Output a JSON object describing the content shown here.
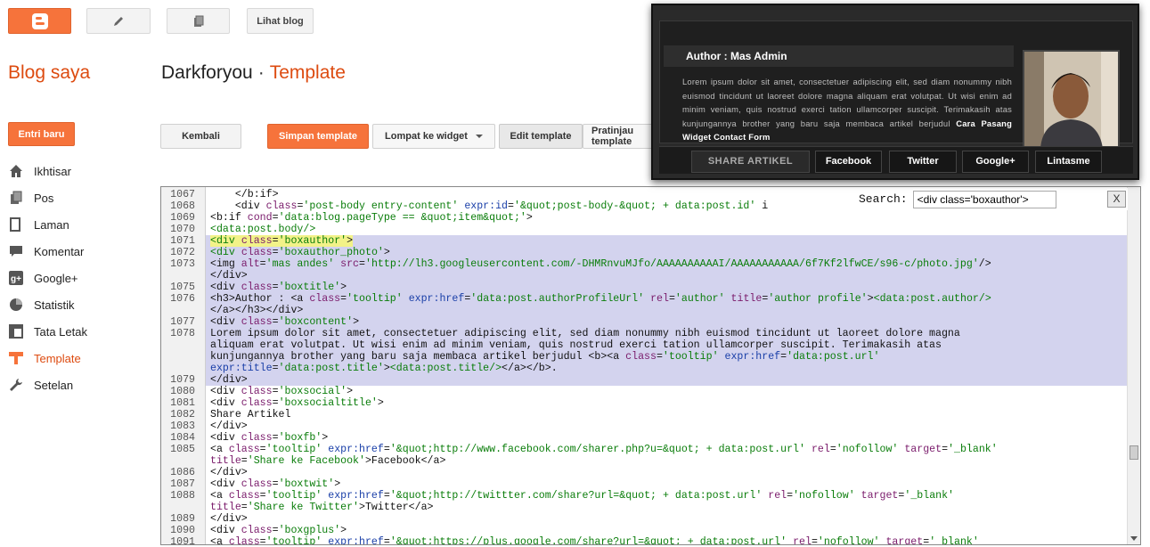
{
  "topbar": {
    "view_blog_label": "Lihat blog"
  },
  "header": {
    "brand": "Blog saya",
    "blog_name": "Darkforyou",
    "separator": "·",
    "section": "Template"
  },
  "sidebar": {
    "new_post_label": "Entri baru",
    "items": [
      {
        "label": "Ikhtisar",
        "icon": "home-icon"
      },
      {
        "label": "Pos",
        "icon": "posts-icon"
      },
      {
        "label": "Laman",
        "icon": "pages-icon"
      },
      {
        "label": "Komentar",
        "icon": "comment-icon"
      },
      {
        "label": "Google+",
        "icon": "google-plus-icon"
      },
      {
        "label": "Statistik",
        "icon": "pie-chart-icon"
      },
      {
        "label": "Tata Letak",
        "icon": "layout-icon"
      },
      {
        "label": "Template",
        "icon": "template-icon",
        "active": true
      },
      {
        "label": "Setelan",
        "icon": "wrench-icon"
      }
    ]
  },
  "toolbar": {
    "back_label": "Kembali",
    "save_label": "Simpan template",
    "jump_label": "Lompat ke widget",
    "edit_label": "Edit template",
    "preview_label": "Pratinjau template"
  },
  "search": {
    "label": "Search:",
    "value": "<div class='boxauthor'>",
    "close_label": "X"
  },
  "widget": {
    "title": "Author : Mas Admin",
    "body": "Lorem ipsum dolor sit amet, consectetuer adipiscing elit, sed diam nonummy nibh euismod tincidunt ut laoreet dolore magna aliquam erat volutpat. Ut wisi enim ad minim veniam, quis nostrud exerci tation ullamcorper suscipit. Terimakasih atas kunjungannya brother yang baru saja membaca artikel berjudul",
    "link": "Cara Pasang Widget Contact Form",
    "share_label": "SHARE ARTIKEL",
    "buttons": [
      "Facebook",
      "Twitter",
      "Google+",
      "Lintasme"
    ]
  },
  "editor": {
    "lines": [
      {
        "n": "1067",
        "html": "    &lt;/b:if&gt;"
      },
      {
        "n": "1068",
        "html": "    &lt;div <span class='p'>class</span>=<span class='g'>'post-body entry-content'</span> <span class='b'>expr:id</span>=<span class='g'>'&amp;quot;post-body-&amp;quot; + data:post.id'</span> i"
      },
      {
        "n": "1069",
        "html": "&lt;b:if <span class='p'>cond</span>=<span class='g'>'data:blog.pageType == &amp;quot;item&amp;quot;'</span>&gt;"
      },
      {
        "n": "1070",
        "html": "<span class='g'>&lt;data:post.body/&gt;</span>"
      },
      {
        "n": "1071",
        "sel": true,
        "hl": true,
        "html": "<span class='first'><span class='g'>&lt;div</span> <span class='p'>class</span>=<span class='g'>'boxauthor'</span>&gt;</span>"
      },
      {
        "n": "1072",
        "sel": true,
        "html": "<span class='g'>&lt;div</span> <span class='p'>class</span>=<span class='g'>'boxauthor_photo'</span>&gt;"
      },
      {
        "n": "1073",
        "sel": true,
        "html": "&lt;img <span class='p'>alt</span>=<span class='g'>'mas andes'</span> <span class='p'>src</span>=<span class='g'>'http://lh3.googleusercontent.com/-DHMRnvuMJfo/AAAAAAAAAAI/AAAAAAAAAAA/6f7Kf2lfwCE/s96-c/photo.jpg'</span>/&gt;"
      },
      {
        "n": "",
        "sel": true,
        "html": "&lt;/div&gt;"
      },
      {
        "n": "1075",
        "sel": true,
        "html": "&lt;div <span class='p'>class</span>=<span class='g'>'boxtitle'</span>&gt;"
      },
      {
        "n": "1076",
        "sel": true,
        "html": "&lt;h3&gt;Author : &lt;a <span class='p'>class</span>=<span class='g'>'tooltip'</span> <span class='b'>expr:href</span>=<span class='g'>'data:post.authorProfileUrl'</span> <span class='p'>rel</span>=<span class='g'>'author'</span> <span class='p'>title</span>=<span class='g'>'author profile'</span>&gt;<span class='g'>&lt;data:post.author/&gt;</span>\n&lt;/a&gt;&lt;/h3&gt;&lt;/div&gt;"
      },
      {
        "n": "1077",
        "sel": true,
        "html": "&lt;div <span class='p'>class</span>=<span class='g'>'boxcontent'</span>&gt;"
      },
      {
        "n": "1078",
        "sel": true,
        "html": "Lorem ipsum dolor sit amet, consectetuer adipiscing elit, sed diam nonummy nibh euismod tincidunt ut laoreet dolore magna\naliquam erat volutpat. Ut wisi enim ad minim veniam, quis nostrud exerci tation ullamcorper suscipit. Terimakasih atas\nkunjungannya brother yang baru saja membaca artikel berjudul &lt;b&gt;&lt;a <span class='p'>class</span>=<span class='g'>'tooltip'</span> <span class='b'>expr:href</span>=<span class='g'>'data:post.url'</span>\n<span class='b'>expr:title</span>=<span class='g'>'data:post.title'</span>&gt;<span class='g'>&lt;data:post.title/&gt;</span>&lt;/a&gt;&lt;/b&gt;."
      },
      {
        "n": "1079",
        "sel": true,
        "html": "&lt;/div&gt;"
      },
      {
        "n": "1080",
        "html": "&lt;div <span class='p'>class</span>=<span class='g'>'boxsocial'</span>&gt;"
      },
      {
        "n": "1081",
        "html": "&lt;div <span class='p'>class</span>=<span class='g'>'boxsocialtitle'</span>&gt;"
      },
      {
        "n": "1082",
        "html": "Share Artikel"
      },
      {
        "n": "1083",
        "html": "&lt;/div&gt;"
      },
      {
        "n": "1084",
        "html": "&lt;div <span class='p'>class</span>=<span class='g'>'boxfb'</span>&gt;"
      },
      {
        "n": "1085",
        "html": "&lt;a <span class='p'>class</span>=<span class='g'>'tooltip'</span> <span class='b'>expr:href</span>=<span class='g'>'&amp;quot;http://www.facebook.com/sharer.php?u=&amp;quot; + data:post.url'</span> <span class='p'>rel</span>=<span class='g'>'nofollow'</span> <span class='p'>target</span>=<span class='g'>'_blank'</span>\n<span class='p'>title</span>=<span class='g'>'Share ke Facebook'</span>&gt;Facebook&lt;/a&gt;"
      },
      {
        "n": "1086",
        "html": "&lt;/div&gt;"
      },
      {
        "n": "1087",
        "html": "&lt;div <span class='p'>class</span>=<span class='g'>'boxtwit'</span>&gt;"
      },
      {
        "n": "1088",
        "html": "&lt;a <span class='p'>class</span>=<span class='g'>'tooltip'</span> <span class='b'>expr:href</span>=<span class='g'>'&amp;quot;http://twittter.com/share?url=&amp;quot; + data:post.url'</span> <span class='p'>rel</span>=<span class='g'>'nofollow'</span> <span class='p'>target</span>=<span class='g'>'_blank'</span>\n<span class='p'>title</span>=<span class='g'>'Share ke Twitter'</span>&gt;Twitter&lt;/a&gt;"
      },
      {
        "n": "1089",
        "html": "&lt;/div&gt;"
      },
      {
        "n": "1090",
        "html": "&lt;div <span class='p'>class</span>=<span class='g'>'boxgplus'</span>&gt;"
      },
      {
        "n": "1091",
        "html": "&lt;a <span class='p'>class</span>=<span class='g'>'tooltip'</span> <span class='b'>expr:href</span>=<span class='g'>'&amp;quot;https://plus.google.com/share?url=&amp;quot; + data:post.url'</span> <span class='p'>rel</span>=<span class='g'>'nofollow'</span> <span class='p'>target</span>=<span class='g'>'_blank'</span>"
      }
    ]
  }
}
